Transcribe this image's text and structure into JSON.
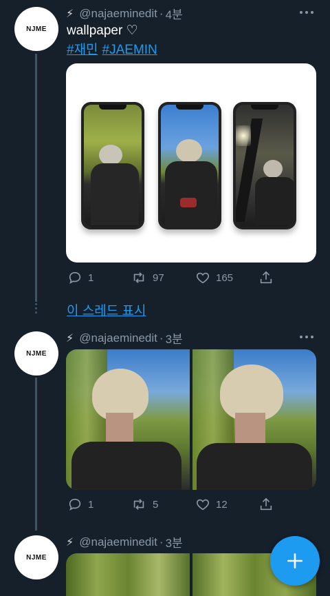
{
  "tweets": [
    {
      "avatar_text": "NJME",
      "handle": "@najaeminedit",
      "time": "4분",
      "text": "wallpaper ♡",
      "hashtags": [
        "#재민",
        "#JAEMIN"
      ],
      "reply_count": "1",
      "retweet_count": "97",
      "like_count": "165"
    },
    {
      "avatar_text": "NJME",
      "handle": "@najaeminedit",
      "time": "3분",
      "reply_count": "1",
      "retweet_count": "5",
      "like_count": "12"
    },
    {
      "avatar_text": "NJME",
      "handle": "@najaeminedit",
      "time": "3분"
    }
  ],
  "show_thread_label": "이 스레드 표시",
  "fab_icon": "plus-icon",
  "colors": {
    "background": "#15202b",
    "accent": "#1d9bf0",
    "secondary_text": "#8b98a5"
  }
}
